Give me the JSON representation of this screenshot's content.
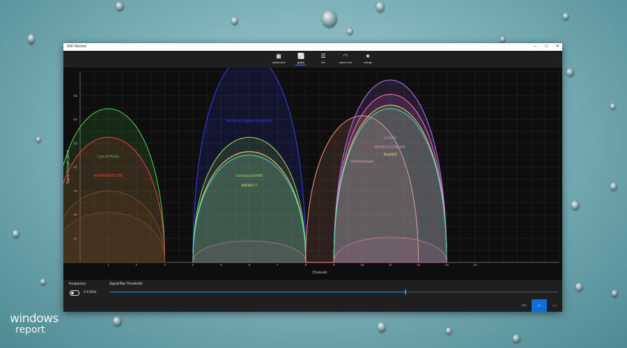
{
  "window": {
    "title": "WiFi Monitor"
  },
  "nav": [
    {
      "label": "dashboard",
      "icon": "grid-icon",
      "glyph": "▦",
      "active": false
    },
    {
      "label": "graph",
      "icon": "graph-icon",
      "glyph": "📈",
      "active": true
    },
    {
      "label": "list",
      "icon": "list-icon",
      "glyph": "☰",
      "active": false
    },
    {
      "label": "speed test",
      "icon": "speedometer-icon",
      "glyph": "◠",
      "active": false
    },
    {
      "label": "ratings",
      "icon": "star-icon",
      "glyph": "★",
      "active": false
    }
  ],
  "chart_data": {
    "type": "area",
    "xlabel": "Channels",
    "ylabel": "Signal Strength [dBm]",
    "ylim": [
      -100,
      -20
    ],
    "xlim": [
      0,
      17
    ],
    "yticks": [
      -30,
      -40,
      -50,
      -60,
      -70,
      -80,
      -90
    ],
    "xticks": [
      1,
      2,
      3,
      4,
      5,
      6,
      7,
      8,
      9,
      10,
      11,
      12,
      13,
      14
    ],
    "grid": true,
    "series": [
      {
        "name": "Lynx & Pearls",
        "channel": 1,
        "dbm": -57,
        "color": "#4fd84f"
      },
      {
        "name": "NVR4900000Z789",
        "channel": 1,
        "dbm": -65,
        "color": "#ff3b3b"
      },
      {
        "name": "",
        "channel": 1,
        "dbm": -80,
        "color": "#7a4a2a"
      },
      {
        "name": "",
        "channel": 1,
        "dbm": -86,
        "color": "#6a4a2a"
      },
      {
        "name": "WFPH-5G Highest Bandwidth",
        "channel": 6,
        "dbm": -42,
        "color": "#3440ff"
      },
      {
        "name": "CenturyLink2665",
        "channel": 6,
        "dbm": -65,
        "color": "#9be84a"
      },
      {
        "name": "INDIGO 7",
        "channel": 6,
        "dbm": -69,
        "color": "#f2e16b"
      },
      {
        "name": "",
        "channel": 6,
        "dbm": -70,
        "color": "#3fe0d0"
      },
      {
        "name": "",
        "channel": 6,
        "dbm": -94,
        "color": "#a06a8a"
      },
      {
        "name": "Windowsreport",
        "channel": 10,
        "dbm": -59,
        "color": "#ff9a80"
      },
      {
        "name": "guest5d",
        "channel": 11,
        "dbm": -49,
        "color": "#b77bff"
      },
      {
        "name": "BHNDG1670A5492",
        "channel": 11,
        "dbm": -53,
        "color": "#ff6fd6"
      },
      {
        "name": "Bright60",
        "channel": 11,
        "dbm": -56,
        "color": "#e0e070"
      },
      {
        "name": "",
        "channel": 11,
        "dbm": -57,
        "color": "#40e0c0"
      },
      {
        "name": "",
        "channel": 11,
        "dbm": -93,
        "color": "#c06fa0"
      }
    ]
  },
  "controls": {
    "frequency_label": "Frequency:",
    "frequency_value": "2.4 GHz",
    "threshold_label": "Signal Bar Threshold:",
    "threshold_fraction": 0.66
  },
  "taskbar": [
    {
      "icon": "chart-icon",
      "glyph": "〰",
      "active": false
    },
    {
      "icon": "arch-icon",
      "glyph": "∩",
      "active": true
    },
    {
      "icon": "more-icon",
      "glyph": "···",
      "active": false
    }
  ],
  "logo": {
    "line1": "windows",
    "line2": "report"
  }
}
